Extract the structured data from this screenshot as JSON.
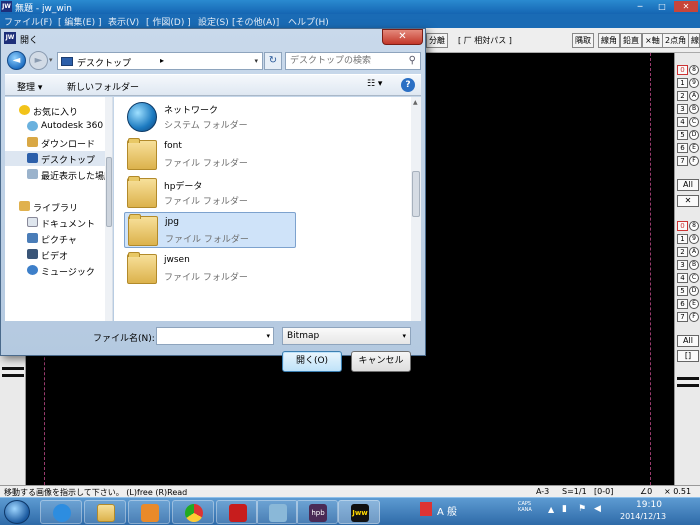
{
  "app": {
    "title": "無題 - jw_win",
    "logo_text": "JW",
    "window_controls": [
      "─",
      "□",
      "✕"
    ],
    "menu": [
      "ファイル(F)",
      "[ 編集(E) ]",
      "表示(V)",
      "[ 作図(D) ]",
      "設定(S)",
      "[その他(A)]",
      "ヘルプ(H)"
    ],
    "toolbar": {
      "left_btn": "分離",
      "mode_text": "[ 厂 相対パス ]",
      "buttons": [
        "隅取",
        "線角",
        "鉛直",
        "×軸",
        "2点角",
        "線"
      ]
    },
    "right_panel": {
      "top_buttons": [
        "0",
        "1",
        "2",
        "3",
        "4",
        "5",
        "6",
        "7"
      ],
      "top_circles": [
        "8",
        "9",
        "A",
        "B",
        "C",
        "D",
        "E",
        "F"
      ],
      "all_label": "All",
      "x_label": "✕",
      "bottom_buttons": [
        "0",
        "1",
        "2",
        "3",
        "4",
        "5",
        "6",
        "7"
      ],
      "bottom_circles": [
        "8",
        "9",
        "A",
        "B",
        "C",
        "D",
        "E",
        "F"
      ],
      "all_label_2": "All",
      "bracket_label": "[]"
    },
    "status": {
      "message": "移動する画像を指示して下さい。 (L)free (R)Read",
      "layer": "A-3",
      "scale": "S=1/1",
      "group": "[0-0]",
      "angle": "∠0",
      "factor": "× 0.51"
    }
  },
  "dialog": {
    "title": "開く",
    "close_label": "✕",
    "back_label": "◄",
    "forward_label": "►",
    "address": "デスクトップ",
    "address_arrow": "▸",
    "refresh_label": "↻",
    "search_placeholder": "デスクトップの検索",
    "search_icon": "⚲",
    "organize_label": "整理 ▾",
    "new_folder_label": "新しいフォルダー",
    "view_label": "☷ ▾",
    "help_label": "?",
    "nav_pane": [
      {
        "label": "お気に入り",
        "icon": "star-icon",
        "group": true
      },
      {
        "label": "Autodesk 360",
        "icon": "cloud-icon"
      },
      {
        "label": "ダウンロード",
        "icon": "download-icon"
      },
      {
        "label": "デスクトップ",
        "icon": "desktop-icon",
        "selected": true
      },
      {
        "label": "最近表示した場所",
        "icon": "recent-icon"
      },
      {
        "label": "ライブラリ",
        "icon": "library-icon",
        "group": true
      },
      {
        "label": "ドキュメント",
        "icon": "document-icon"
      },
      {
        "label": "ピクチャ",
        "icon": "picture-icon"
      },
      {
        "label": "ビデオ",
        "icon": "video-icon"
      },
      {
        "label": "ミュージック",
        "icon": "music-icon"
      }
    ],
    "files": [
      {
        "name": "ネットワーク",
        "type": "システム フォルダー",
        "icon": "network-icon"
      },
      {
        "name": "font",
        "type": "ファイル フォルダー",
        "icon": "folder-icon"
      },
      {
        "name": "hpデータ",
        "type": "ファイル フォルダー",
        "icon": "folder-icon"
      },
      {
        "name": "jpg",
        "type": "ファイル フォルダー",
        "icon": "folder-icon",
        "selected": true
      },
      {
        "name": "jwsen",
        "type": "ファイル フォルダー",
        "icon": "folder-icon"
      }
    ],
    "filename_label": "ファイル名(N):",
    "filename_value": "",
    "filetype_value": "Bitmap",
    "open_label": "開く(O)",
    "cancel_label": "キャンセル"
  },
  "taskbar": {
    "apps": [
      "start-button",
      "ie-icon",
      "explorer-icon",
      "media-player-icon",
      "chrome-icon",
      "acrobat-icon",
      "app-icon",
      "hpb-icon",
      "jww-icon"
    ],
    "hpb_label": "hpb",
    "jww_label": "Jww",
    "ime_text": "A 般",
    "time": "19:10",
    "date": "2014/12/13",
    "caps_text": "CAPS KANA"
  },
  "colors": {
    "taskbar": "#2e6aa8",
    "dialog_frame": "#b4c9e0",
    "selection": "#cfe3f9",
    "close_red": "#c3372a"
  }
}
